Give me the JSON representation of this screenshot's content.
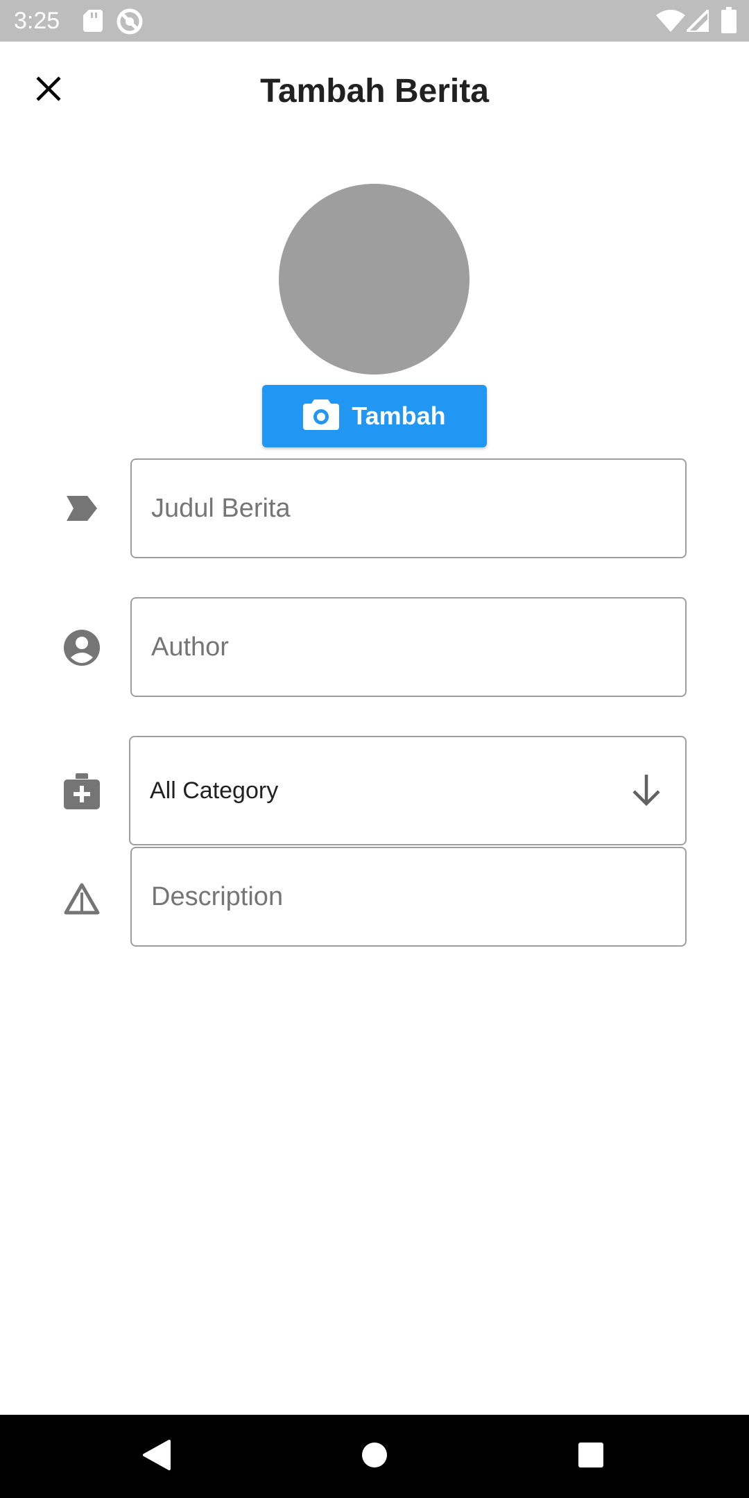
{
  "status_bar": {
    "time": "3:25",
    "icons": [
      "sd-card-icon",
      "sync-disabled-icon",
      "wifi-icon",
      "signal-icon",
      "battery-icon"
    ]
  },
  "app_bar": {
    "title": "Tambah Berita",
    "close_icon": "close-icon"
  },
  "photo": {
    "add_button_label": "Tambah",
    "button_icon": "camera-icon",
    "avatar_color": "#9e9e9e",
    "button_color": "#2196f3"
  },
  "form": {
    "title_field": {
      "icon": "label-icon",
      "placeholder": "Judul Berita",
      "value": ""
    },
    "author_field": {
      "icon": "account-circle-icon",
      "placeholder": "Author",
      "value": ""
    },
    "category_dropdown": {
      "icon": "medical-bag-icon",
      "selected": "All Category",
      "arrow_icon": "arrow-down-icon"
    },
    "description_field": {
      "icon": "warning-outline-icon",
      "placeholder": "Description",
      "value": ""
    }
  },
  "nav_bar": {
    "back_icon": "back-triangle-icon",
    "home_icon": "home-circle-icon",
    "recents_icon": "recents-square-icon"
  }
}
